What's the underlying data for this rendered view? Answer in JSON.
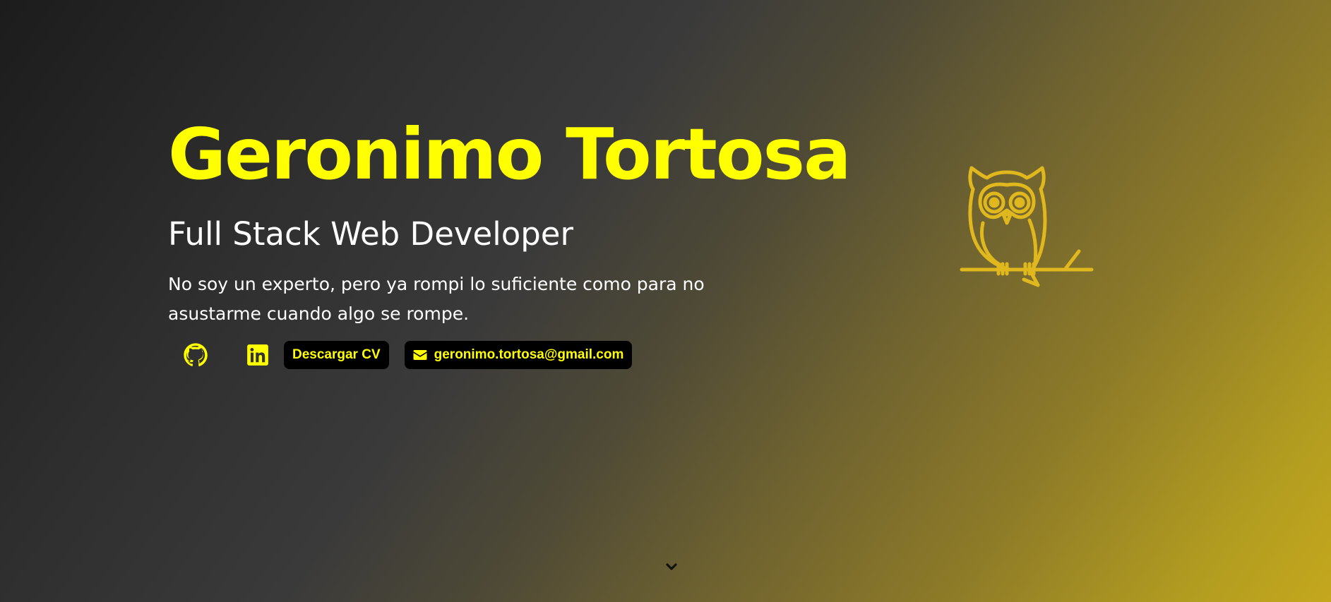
{
  "hero": {
    "name": "Geronimo Tortosa",
    "role": "Full Stack Web Developer",
    "bio": "No soy un experto, pero ya rompi lo suficiente como para no asustarme cuando algo se rompe."
  },
  "actions": {
    "github_icon": "github-icon",
    "linkedin_icon": "linkedin-icon",
    "cv_label": "Descargar CV",
    "email_label": "geronimo.tortosa@gmail.com",
    "email_icon": "envelope-icon"
  },
  "decor": {
    "owl_icon": "owl-icon",
    "scroll_icon": "chevron-down-icon"
  },
  "colors": {
    "accent": "#ffff00",
    "owl": "#e0b81e",
    "button_bg": "#000000",
    "text": "#ffffff"
  }
}
